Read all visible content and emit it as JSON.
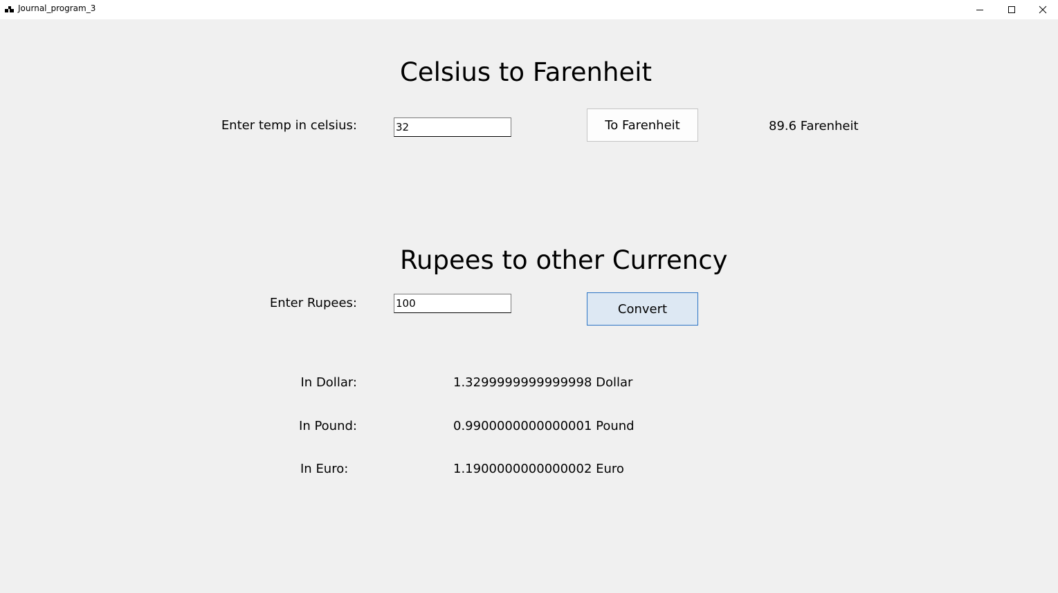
{
  "window": {
    "title": "Journal_program_3",
    "icons": {
      "app": "app-icon",
      "minimize": "minimize-icon",
      "maximize": "maximize-icon",
      "close": "close-icon"
    }
  },
  "temperature": {
    "heading": "Celsius to Farenheit",
    "input_label": "Enter temp in celsius:",
    "input_value": "32",
    "button_label": "To Farenheit",
    "result": "89.6 Farenheit"
  },
  "currency": {
    "heading": "Rupees to other Currency",
    "input_label": "Enter Rupees:",
    "input_value": "100",
    "button_label": "Convert",
    "results": [
      {
        "label": "In Dollar:",
        "value": "1.3299999999999998 Dollar"
      },
      {
        "label": "In Pound:",
        "value": "0.9900000000000001 Pound"
      },
      {
        "label": "In Euro:",
        "value": "1.1900000000000002 Euro"
      }
    ]
  },
  "colors": {
    "background": "#f0f0f0",
    "titlebar": "#ffffff",
    "focused_button_bg": "#dde8f3",
    "focused_button_border": "#2c74c4"
  }
}
